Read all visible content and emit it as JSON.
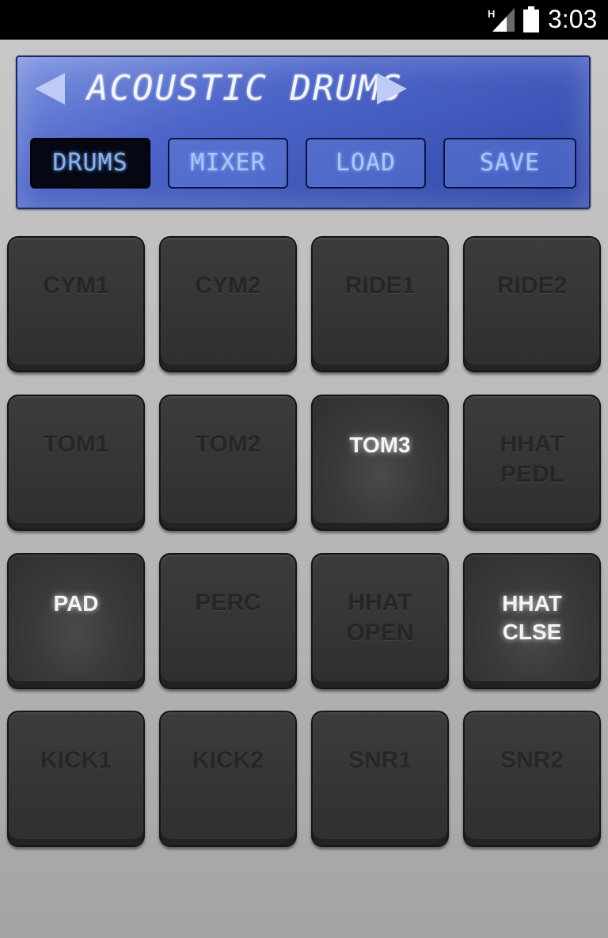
{
  "status_bar": {
    "network_type": "H",
    "time": "3:03",
    "icons": [
      "signal-icon",
      "battery-icon"
    ]
  },
  "kit_selector": {
    "title": "ACOUSTIC DRUMS",
    "prev_icon": "triangle-left-icon",
    "next_icon": "triangle-right-icon"
  },
  "menu": {
    "items": [
      {
        "label": "DRUMS",
        "active": true
      },
      {
        "label": "MIXER",
        "active": false
      },
      {
        "label": "LOAD",
        "active": false
      },
      {
        "label": "SAVE",
        "active": false
      }
    ]
  },
  "pads": [
    {
      "label": "CYM1",
      "lit": false
    },
    {
      "label": "CYM2",
      "lit": false
    },
    {
      "label": "RIDE1",
      "lit": false
    },
    {
      "label": "RIDE2",
      "lit": false
    },
    {
      "label": "TOM1",
      "lit": false
    },
    {
      "label": "TOM2",
      "lit": false
    },
    {
      "label": "TOM3",
      "lit": true
    },
    {
      "label": "HHAT\nPEDL",
      "lit": false
    },
    {
      "label": "PAD",
      "lit": true
    },
    {
      "label": "PERC",
      "lit": false
    },
    {
      "label": "HHAT\nOPEN",
      "lit": false
    },
    {
      "label": "HHAT\nCLSE",
      "lit": true
    },
    {
      "label": "KICK1",
      "lit": false
    },
    {
      "label": "KICK2",
      "lit": false
    },
    {
      "label": "SNR1",
      "lit": false
    },
    {
      "label": "SNR2",
      "lit": false
    }
  ],
  "colors": {
    "lcd_blue": "#3f58bd",
    "lcd_text": "#a9c6ff",
    "pad_dark": "#333333",
    "pad_lit_text": "#f4f4f4"
  }
}
